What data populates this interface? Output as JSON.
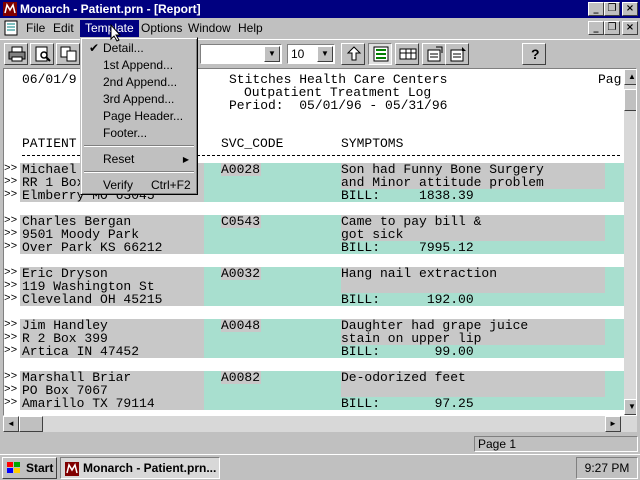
{
  "window": {
    "title": "Monarch - Patient.prn - [Report]"
  },
  "menubar": {
    "items": [
      {
        "label": "File"
      },
      {
        "label": "Edit"
      },
      {
        "label": "Template"
      },
      {
        "label": "Options"
      },
      {
        "label": "Window"
      },
      {
        "label": "Help"
      }
    ]
  },
  "template_menu": {
    "items": [
      {
        "label": "Detail...",
        "checked": true
      },
      {
        "label": "1st Append..."
      },
      {
        "label": "2nd Append..."
      },
      {
        "label": "3rd Append..."
      },
      {
        "label": "Page Header..."
      },
      {
        "label": "Footer..."
      },
      {
        "label": "Reset"
      },
      {
        "label": "Verify",
        "shortcut": "Ctrl+F2"
      }
    ]
  },
  "toolbar": {
    "font_size": "10",
    "help_label": "?"
  },
  "report": {
    "header_left": "06/01/9",
    "header_right": "Pag",
    "company": "Stitches Health Care Centers",
    "log_title": "Outpatient Treatment Log",
    "period": "Period:  05/01/96 - 05/31/96",
    "columns": {
      "patient": "PATIENT",
      "svc_code": "SVC_CODE",
      "symptoms": "SYMPTOMS"
    },
    "row_marker": ">>",
    "records": [
      {
        "name": "Michael",
        "address": "RR 1 Box",
        "city": "Elmberry MO 63045",
        "svc": "A0028",
        "symptom1": "Son had Funny Bone Surgery",
        "symptom2": "and Minor attitude problem",
        "bill": "BILL:     1838.39"
      },
      {
        "name": "Charles Bergan",
        "address": "9501 Moody Park",
        "city": "Over Park KS 66212",
        "svc": "C0543",
        "symptom1": "Came to pay bill &",
        "symptom2": "got sick",
        "bill": "BILL:     7995.12"
      },
      {
        "name": "Eric Dryson",
        "address": "119 Washington St",
        "city": "Cleveland OH 45215",
        "svc": "A0032",
        "symptom1": "Hang nail extraction",
        "symptom2": "",
        "bill": "BILL:      192.00"
      },
      {
        "name": "Jim Handley",
        "address": "R 2 Box 399",
        "city": "Artica IN 47452",
        "svc": "A0048",
        "symptom1": "Daughter had grape juice",
        "symptom2": "stain on upper lip",
        "bill": "BILL:       99.00"
      },
      {
        "name": "Marshall Briar",
        "address": "PO Box 7067",
        "city": "Amarillo TX 79114",
        "svc": "A0082",
        "symptom1": "De-odorized feet",
        "symptom2": "",
        "bill": "BILL:       97.25"
      }
    ]
  },
  "status": {
    "page": "Page 1"
  },
  "taskbar": {
    "start": "Start",
    "task": "Monarch - Patient.prn...",
    "time": "9:27 PM"
  },
  "colors": {
    "titlebar": "#000080",
    "highlight_teal": "#a8dfcf",
    "highlight_grey": "#c8c8c8"
  }
}
